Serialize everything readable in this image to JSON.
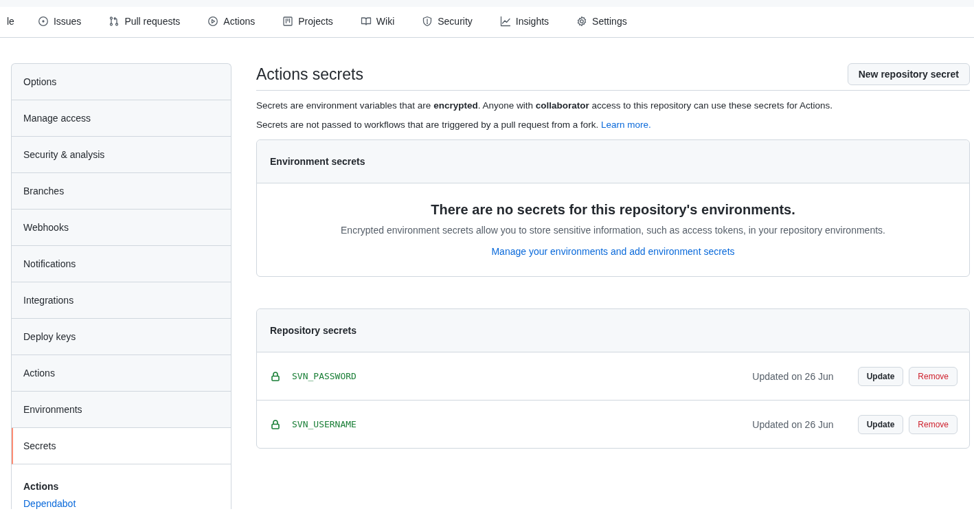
{
  "repo_nav": {
    "tabs": [
      {
        "label": "le"
      },
      {
        "label": "Issues"
      },
      {
        "label": "Pull requests"
      },
      {
        "label": "Actions"
      },
      {
        "label": "Projects"
      },
      {
        "label": "Wiki"
      },
      {
        "label": "Security"
      },
      {
        "label": "Insights"
      },
      {
        "label": "Settings"
      }
    ]
  },
  "sidebar": {
    "items": [
      {
        "label": "Options",
        "selected": false
      },
      {
        "label": "Manage access",
        "selected": false
      },
      {
        "label": "Security & analysis",
        "selected": false
      },
      {
        "label": "Branches",
        "selected": false
      },
      {
        "label": "Webhooks",
        "selected": false
      },
      {
        "label": "Notifications",
        "selected": false
      },
      {
        "label": "Integrations",
        "selected": false
      },
      {
        "label": "Deploy keys",
        "selected": false
      },
      {
        "label": "Actions",
        "selected": false
      },
      {
        "label": "Environments",
        "selected": false
      },
      {
        "label": "Secrets",
        "selected": true
      }
    ],
    "section": {
      "heading": "Actions",
      "links": [
        "Dependabot"
      ]
    }
  },
  "main": {
    "title": "Actions secrets",
    "new_button": "New repository secret",
    "notes": [
      {
        "text": "Secrets are environment variables that are **encrypted**. Anyone with **collaborator** access to this repository can use these secrets for Actions."
      },
      {
        "text": "Secrets are not passed to workflows that are triggered by a pull request from a fork.",
        "link": "Learn more."
      }
    ],
    "environment_secrets": {
      "header": "Environment secrets",
      "blank_title": "There are no secrets for this repository's environments.",
      "blank_text": "Encrypted environment secrets allow you to store sensitive information, such as access tokens, in your repository environments.",
      "blank_link": "Manage your environments and add environment secrets"
    },
    "repository_secrets": {
      "header": "Repository secrets",
      "rows": [
        {
          "name": "SVN_PASSWORD",
          "updated": "Updated on 26 Jun",
          "update_button": "Update",
          "remove_button": "Remove"
        },
        {
          "name": "SVN_USERNAME",
          "updated": "Updated on 26 Jun",
          "update_button": "Update",
          "remove_button": "Remove"
        }
      ]
    }
  }
}
